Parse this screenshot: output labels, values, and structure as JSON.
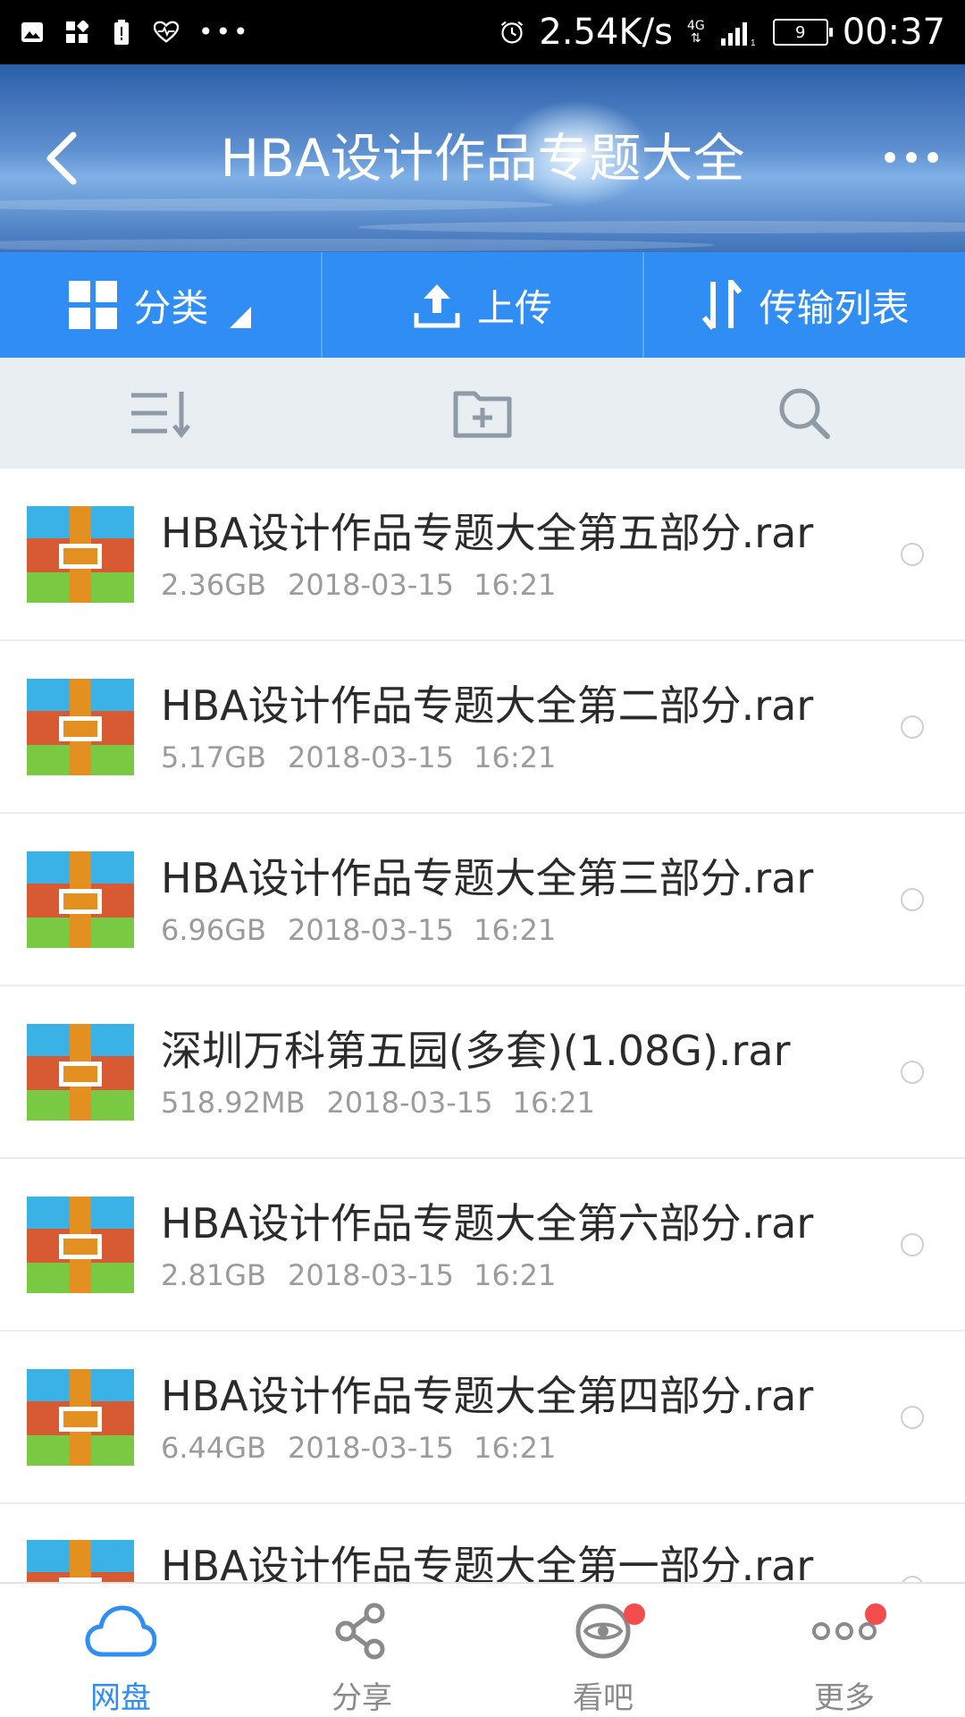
{
  "status_bar": {
    "speed": "2.54K/s",
    "network": "4G",
    "sim_slot": "1",
    "battery": "9",
    "time": "00:37",
    "icons": [
      "image-icon",
      "app-icon",
      "alert-battery-icon",
      "heartbeat-icon",
      "more-dots-icon",
      "alarm-icon",
      "signal-icon"
    ]
  },
  "header": {
    "title": "HBA设计作品专题大全",
    "back_icon": "chevron-left-icon",
    "more_icon": "more-dots-icon"
  },
  "tabs": [
    {
      "label": "分类",
      "icon": "grid-icon"
    },
    {
      "label": "上传",
      "icon": "upload-icon"
    },
    {
      "label": "传输列表",
      "icon": "transfer-arrows-icon"
    }
  ],
  "tools": [
    {
      "icon": "sort-icon"
    },
    {
      "icon": "new-folder-icon"
    },
    {
      "icon": "search-icon"
    }
  ],
  "files": [
    {
      "name": "HBA设计作品专题大全第五部分.rar",
      "size": "2.36GB",
      "date": "2018-03-15",
      "time": "16:21"
    },
    {
      "name": "HBA设计作品专题大全第二部分.rar",
      "size": "5.17GB",
      "date": "2018-03-15",
      "time": "16:21"
    },
    {
      "name": "HBA设计作品专题大全第三部分.rar",
      "size": "6.96GB",
      "date": "2018-03-15",
      "time": "16:21"
    },
    {
      "name": "深圳万科第五园(多套)(1.08G).rar",
      "size": "518.92MB",
      "date": "2018-03-15",
      "time": "16:21"
    },
    {
      "name": "HBA设计作品专题大全第六部分.rar",
      "size": "2.81GB",
      "date": "2018-03-15",
      "time": "16:21"
    },
    {
      "name": "HBA设计作品专题大全第四部分.rar",
      "size": "6.44GB",
      "date": "2018-03-15",
      "time": "16:21"
    },
    {
      "name": "HBA设计作品专题大全第一部分.rar",
      "size": "",
      "date": "",
      "time": ""
    }
  ],
  "bottom_nav": [
    {
      "label": "网盘",
      "icon": "cloud-icon",
      "active": true,
      "badge": false
    },
    {
      "label": "分享",
      "icon": "share-icon",
      "active": false,
      "badge": false
    },
    {
      "label": "看吧",
      "icon": "eye-icon",
      "active": false,
      "badge": true
    },
    {
      "label": "更多",
      "icon": "more-circles-icon",
      "active": false,
      "badge": true
    }
  ],
  "colors": {
    "accent": "#2f8df3",
    "tool_bg": "#e9eef3",
    "badge": "#f24c4c"
  }
}
